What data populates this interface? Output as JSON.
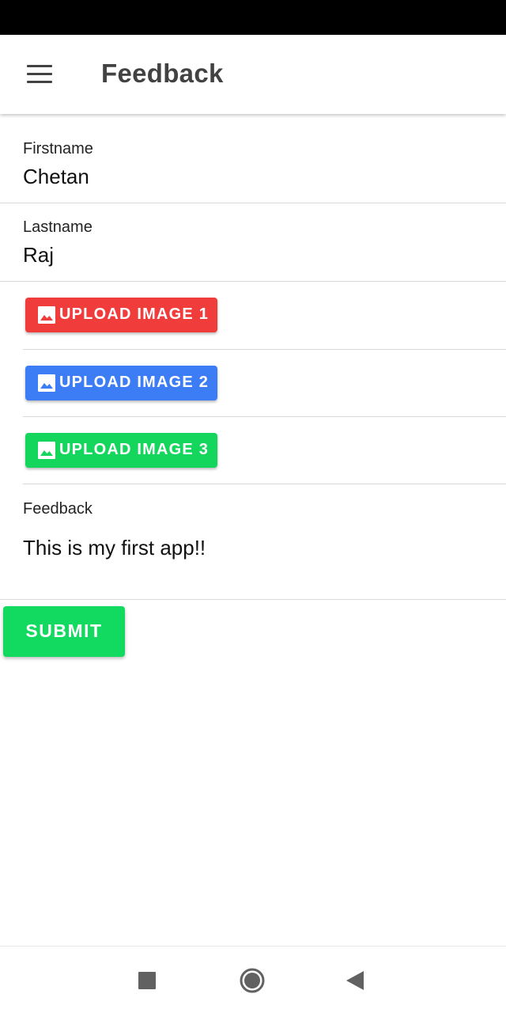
{
  "app_bar": {
    "title": "Feedback",
    "menu_icon": "hamburger-menu-icon"
  },
  "form": {
    "firstname": {
      "label": "Firstname",
      "value": "Chetan"
    },
    "lastname": {
      "label": "Lastname",
      "value": "Raj"
    },
    "uploads": [
      {
        "label": "UPLOAD IMAGE 1",
        "color": "#f13c3c",
        "icon": "image-icon"
      },
      {
        "label": "UPLOAD IMAGE 2",
        "color": "#3c7df5",
        "icon": "image-icon"
      },
      {
        "label": "UPLOAD IMAGE 3",
        "color": "#15d65c",
        "icon": "image-icon"
      }
    ],
    "feedback": {
      "label": "Feedback",
      "value": "This is my first app!!"
    },
    "submit_label": "SUBMIT",
    "submit_color": "#12d95f"
  },
  "nav_bar": {
    "recents_icon": "square-recents-icon",
    "home_icon": "circle-home-icon",
    "back_icon": "triangle-back-icon"
  }
}
